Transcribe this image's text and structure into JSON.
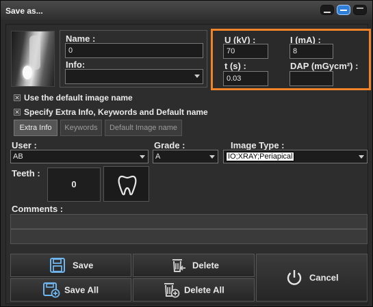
{
  "window": {
    "title": "Save as..."
  },
  "left": {
    "name_label": "Name :",
    "name_value": "0",
    "info_label": "Info:",
    "info_value": ""
  },
  "exposure": {
    "u_label": "U (kV) :",
    "u_value": "70",
    "i_label": "I (mA) :",
    "i_value": "8",
    "t_label": "t (s) :",
    "t_value": "0.03",
    "dap_label": "DAP (mGycm²) :",
    "dap_value": ""
  },
  "options": {
    "default_name_label": "Use the default image name",
    "default_name_checked": true,
    "extra_info_label": "Specify Extra Info, Keywords and Default name",
    "extra_info_checked": true
  },
  "tabs": [
    "Extra Info",
    "Keywords",
    "Default Image name"
  ],
  "active_tab": "Extra Info",
  "form": {
    "user_label": "User :",
    "user_value": "AB",
    "grade_label": "Grade :",
    "grade_value": "A",
    "image_type_label": "Image Type :",
    "image_type_value": "IO;XRAY;Periapical",
    "teeth_label": "Teeth :",
    "teeth_value": "0",
    "comments_label": "Comments :"
  },
  "buttons": {
    "save": "Save",
    "delete": "Delete",
    "save_all": "Save All",
    "delete_all": "Delete All",
    "cancel": "Cancel"
  },
  "colors": {
    "highlight": "#f0842b",
    "accent": "#2f7fd8"
  },
  "icons": [
    "floppy-icon",
    "trash-arrow-icon",
    "floppy-plus-icon",
    "trash-plus-icon",
    "power-icon",
    "tooth-icon"
  ]
}
